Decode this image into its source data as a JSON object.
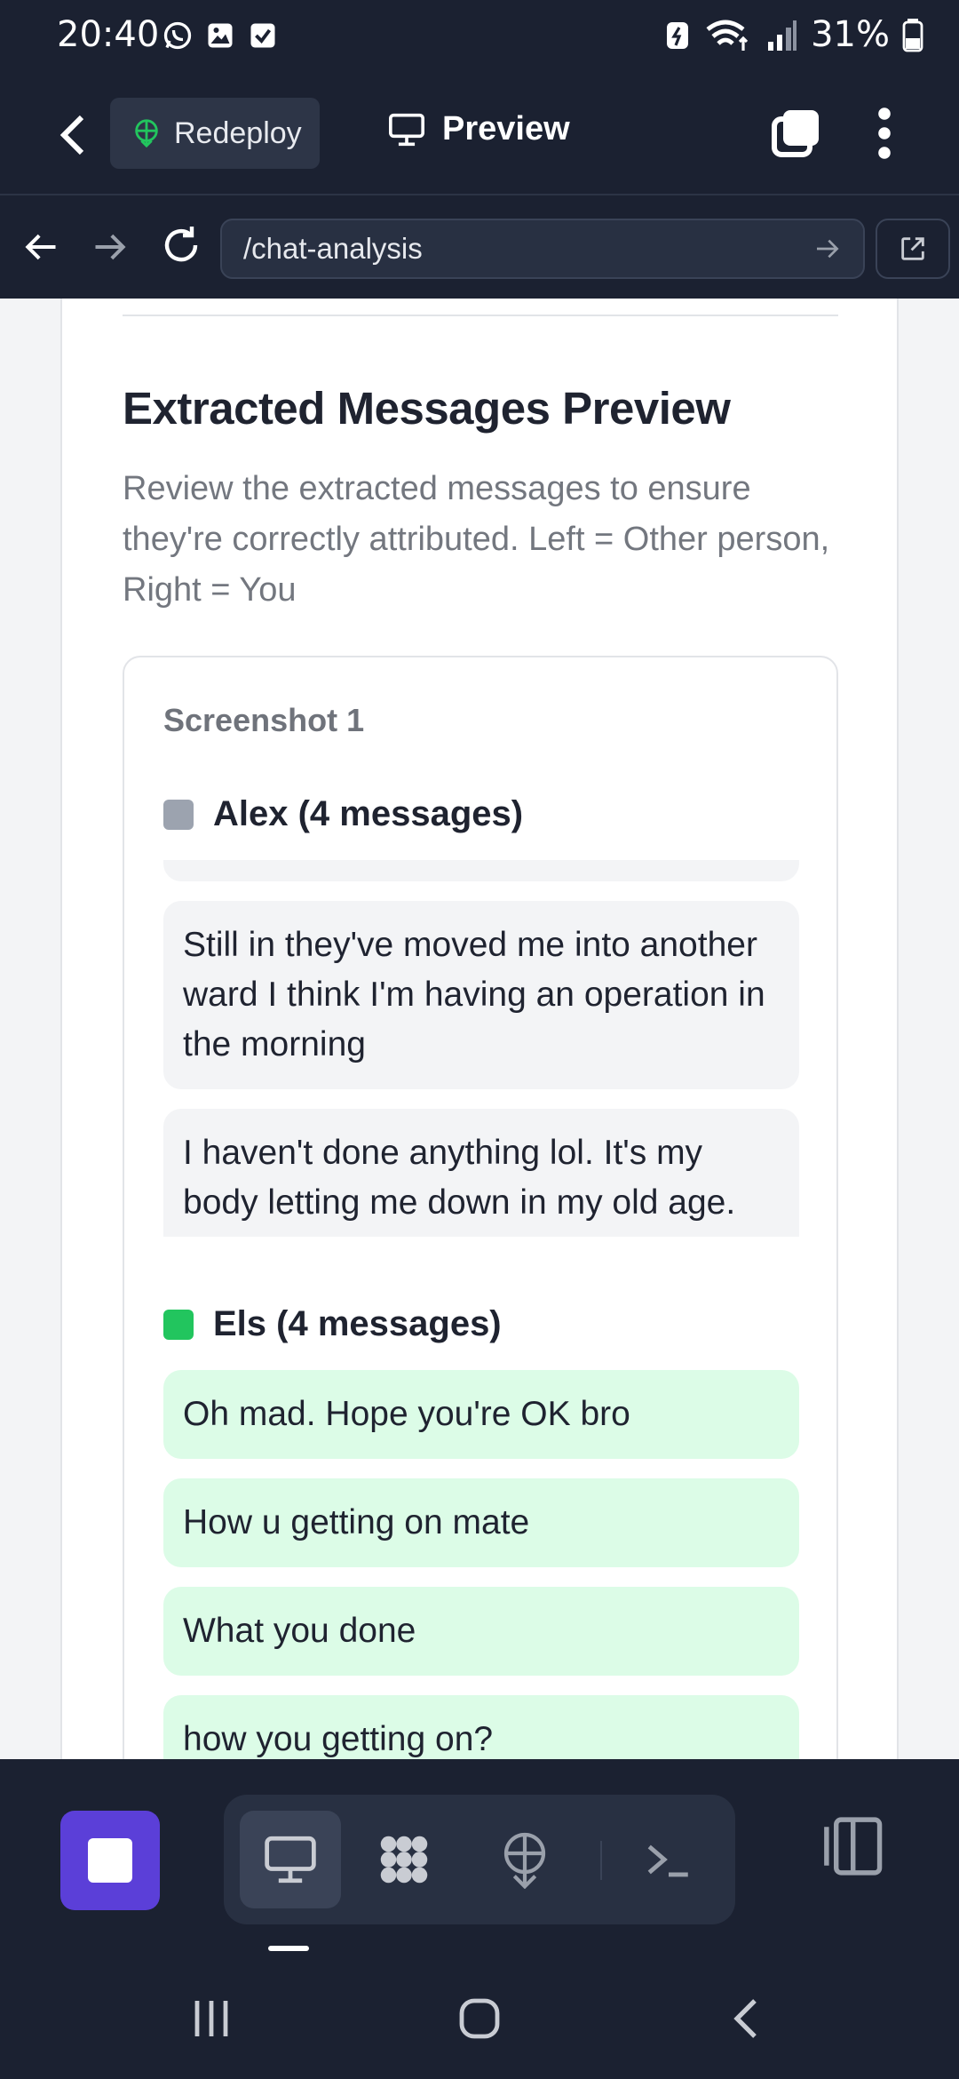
{
  "status_bar": {
    "time": "20:40",
    "battery": "31%"
  },
  "header": {
    "redeploy_label": "Redeploy",
    "preview_label": "Preview"
  },
  "url_bar": {
    "url": "/chat-analysis"
  },
  "main": {
    "title": "Extracted Messages Preview",
    "description": "Review the extracted messages to ensure they're correctly attributed. Left = Other person, Right = You",
    "screenshot": {
      "title": "Screenshot 1",
      "other": {
        "label": "Alex (4 messages)",
        "color": "#9ca3af",
        "messages": [
          "Still in they've moved me into another ward I think I'm having an operation in the morning",
          "I haven't done anything lol. It's my body letting me down in my old age. Partly to do with my diet and"
        ]
      },
      "you": {
        "label": "Els (4 messages)",
        "color": "#22c55e",
        "messages": [
          "Oh mad. Hope you're OK bro",
          "How u getting on mate",
          "What you done",
          "how you getting on?"
        ]
      }
    }
  },
  "colors": {
    "accent": "#5b3fd8",
    "you_bubble": "#dcfce7",
    "other_bubble": "#f3f4f6"
  },
  "icons": {
    "app_header": [
      "back-arrow-icon",
      "redeploy-icon",
      "monitor-icon",
      "tabs-icon",
      "more-vertical-icon"
    ],
    "toolbar": [
      "stop-icon",
      "monitor-icon",
      "workflow-icon",
      "deploy-icon",
      "terminal-icon",
      "panel-icon"
    ]
  }
}
